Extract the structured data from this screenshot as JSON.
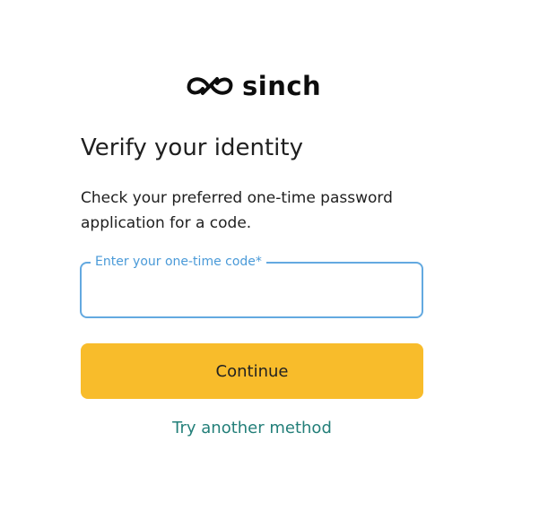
{
  "logo": {
    "text": "sinch",
    "icon": "infinity-link-icon",
    "color": "#0d0d0d"
  },
  "heading": {
    "title": "Verify your identity",
    "description": "Check your preferred one-time password application for a code."
  },
  "form": {
    "code_label": "Enter your one-time code*",
    "code_value": "",
    "continue_label": "Continue",
    "alternate_link": "Try another method"
  },
  "colors": {
    "accent_button": "#f8bc2b",
    "field_border": "#63a9e0",
    "field_label": "#4a9ad8",
    "link": "#237f79",
    "text": "#1f1f1f"
  }
}
